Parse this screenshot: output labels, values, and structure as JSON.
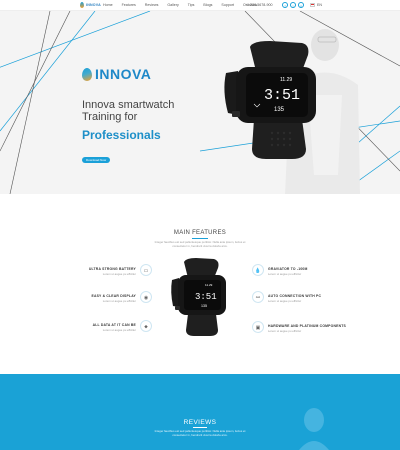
{
  "nav": {
    "logo_text": "INNOVA",
    "menu": [
      "Home",
      "Features",
      "Reviews",
      "Gallery",
      "Tips",
      "Blogs",
      "Support",
      "Contacts"
    ],
    "phone": "+1 234-5678-900",
    "social": [
      "f",
      "t",
      "g"
    ],
    "lang": "EN"
  },
  "hero": {
    "brand": "INNOVA",
    "line1": "Innova smartwatch",
    "line2": "Training for",
    "line3": "Professionals",
    "cta": "Download Now",
    "watch": {
      "time": "3:51",
      "top": "11.29",
      "bottom": "135"
    }
  },
  "features": {
    "title": "MAIN FEATURES",
    "subtitle": "Integer faucibus est sed pellentesque porttitor. Nulla ante ipsum, luctus et consectetur in, hendrerit viverra dolorla arcu.",
    "left": [
      {
        "title": "ULTRA STRONG BATTERY",
        "desc": "Lorem ut augue pu efficitur",
        "icon": "battery-icon",
        "glyph": "▭"
      },
      {
        "title": "EASY & CLEAR DISPLAY",
        "desc": "Lorem ut augue pu efficitur",
        "icon": "eye-icon",
        "glyph": "◉"
      },
      {
        "title": "ALL DATA AT IT CAN BE",
        "desc": "Lorem ut augue pu efficitur",
        "icon": "pin-icon",
        "glyph": "⬥"
      }
    ],
    "right": [
      {
        "title": "GRAVIATOR TO -100M",
        "desc": "Lorem ut augue pu efficitur",
        "icon": "drop-icon",
        "glyph": "💧"
      },
      {
        "title": "AUTO CONNECTION WITH PC",
        "desc": "Lorem ut augue pu efficitur",
        "icon": "link-icon",
        "glyph": "⚯"
      },
      {
        "title": "HARDWARE AND PLATINUM COMPONENTS",
        "desc": "Lorem ut augue pu efficitur",
        "icon": "chip-icon",
        "glyph": "▣"
      }
    ],
    "watch": {
      "time": "3:51",
      "top": "11.29",
      "bottom": "135"
    }
  },
  "reviews": {
    "title": "REVIEWS",
    "subtitle": "Integer faucibus est sed pellentesque porttitor. Nulla ante ipsum, luctus et consectetur in, hendrerit viverra dolorla arcu."
  },
  "colors": {
    "accent": "#1aa0d8",
    "accent_dark": "#1e88c8",
    "hero_bg": "#f4f4f4",
    "reviews_bg": "#1aa2d6"
  }
}
